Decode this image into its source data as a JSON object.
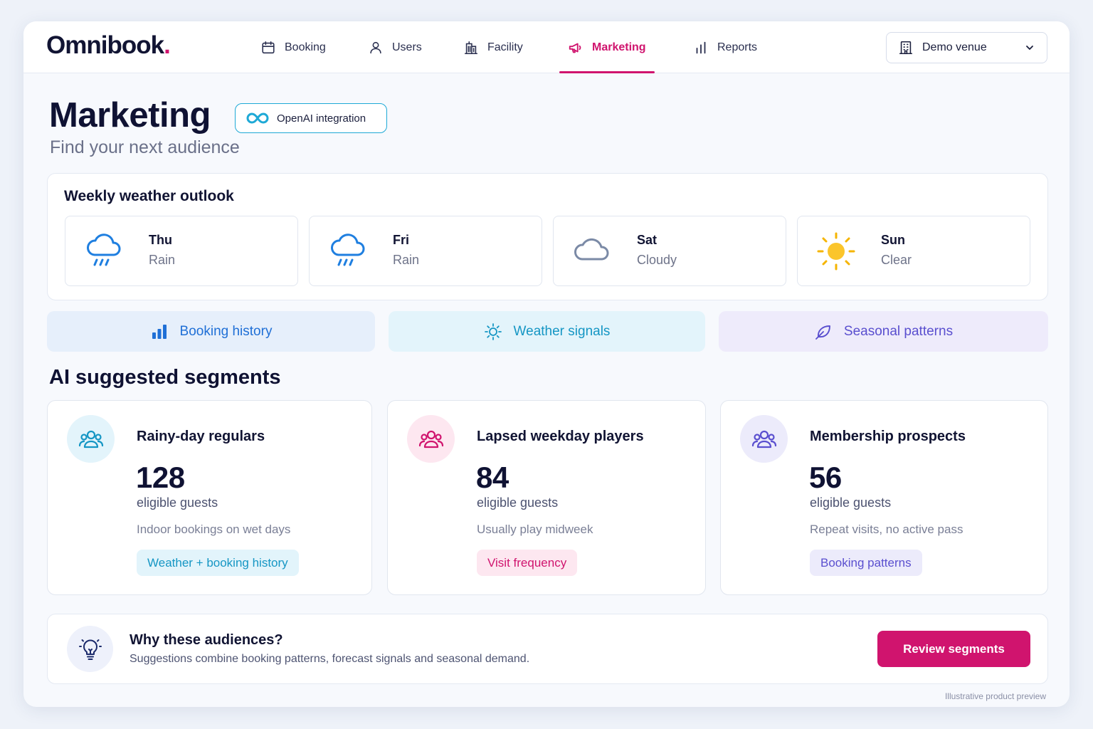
{
  "app": {
    "logo_text": "Omnibook",
    "logo_dot": ".",
    "brand_color": "#d0146e"
  },
  "nav": {
    "items": [
      {
        "label": "Booking",
        "icon": "calendar-icon",
        "active": false
      },
      {
        "label": "Users",
        "icon": "user-icon",
        "active": false
      },
      {
        "label": "Facility",
        "icon": "building-icon",
        "active": false
      },
      {
        "label": "Marketing",
        "icon": "megaphone-icon",
        "active": true
      },
      {
        "label": "Reports",
        "icon": "bar-chart-icon",
        "active": false
      }
    ]
  },
  "venue_select": {
    "value": "Demo venue",
    "icon": "building-icon"
  },
  "header": {
    "title": "Marketing",
    "badge": "OpenAI integration",
    "subtitle": "Find your next audience"
  },
  "weather": {
    "title": "Weekly weather outlook",
    "days": [
      {
        "day": "Thu",
        "condition": "Rain",
        "icon": "rain-cloud-icon"
      },
      {
        "day": "Fri",
        "condition": "Rain",
        "icon": "rain-cloud-icon"
      },
      {
        "day": "Sat",
        "condition": "Cloudy",
        "icon": "cloud-icon"
      },
      {
        "day": "Sun",
        "condition": "Clear",
        "icon": "sun-icon"
      }
    ]
  },
  "sources": [
    {
      "label": "Booking history",
      "icon": "bar-chart-icon",
      "color": "#1f6fd6"
    },
    {
      "label": "Weather signals",
      "icon": "sun-icon",
      "color": "#1596c4"
    },
    {
      "label": "Seasonal patterns",
      "icon": "leaf-icon",
      "color": "#5a4fcf"
    }
  ],
  "segments": {
    "title": "AI suggested segments",
    "items": [
      {
        "name": "Rainy-day regulars",
        "count": "128",
        "unit": "eligible guests",
        "description": "Indoor bookings on wet days",
        "tag": "Weather + booking history",
        "accent": "#1596c4",
        "tag_bg": "#e2f4fb"
      },
      {
        "name": "Lapsed weekday players",
        "count": "84",
        "unit": "eligible guests",
        "description": "Usually play midweek",
        "tag": "Visit frequency",
        "accent": "#d0146e",
        "tag_bg": "#fde7f0"
      },
      {
        "name": "Membership prospects",
        "count": "56",
        "unit": "eligible guests",
        "description": "Repeat visits, no active pass",
        "tag": "Booking patterns",
        "accent": "#5a4fcf",
        "tag_bg": "#ecebfb"
      }
    ]
  },
  "info": {
    "title": "Why these audiences?",
    "text": "Suggestions combine booking patterns, forecast signals and seasonal demand.",
    "button": "Review segments",
    "icon": "lightbulb-icon"
  },
  "footnote": "Illustrative product preview"
}
